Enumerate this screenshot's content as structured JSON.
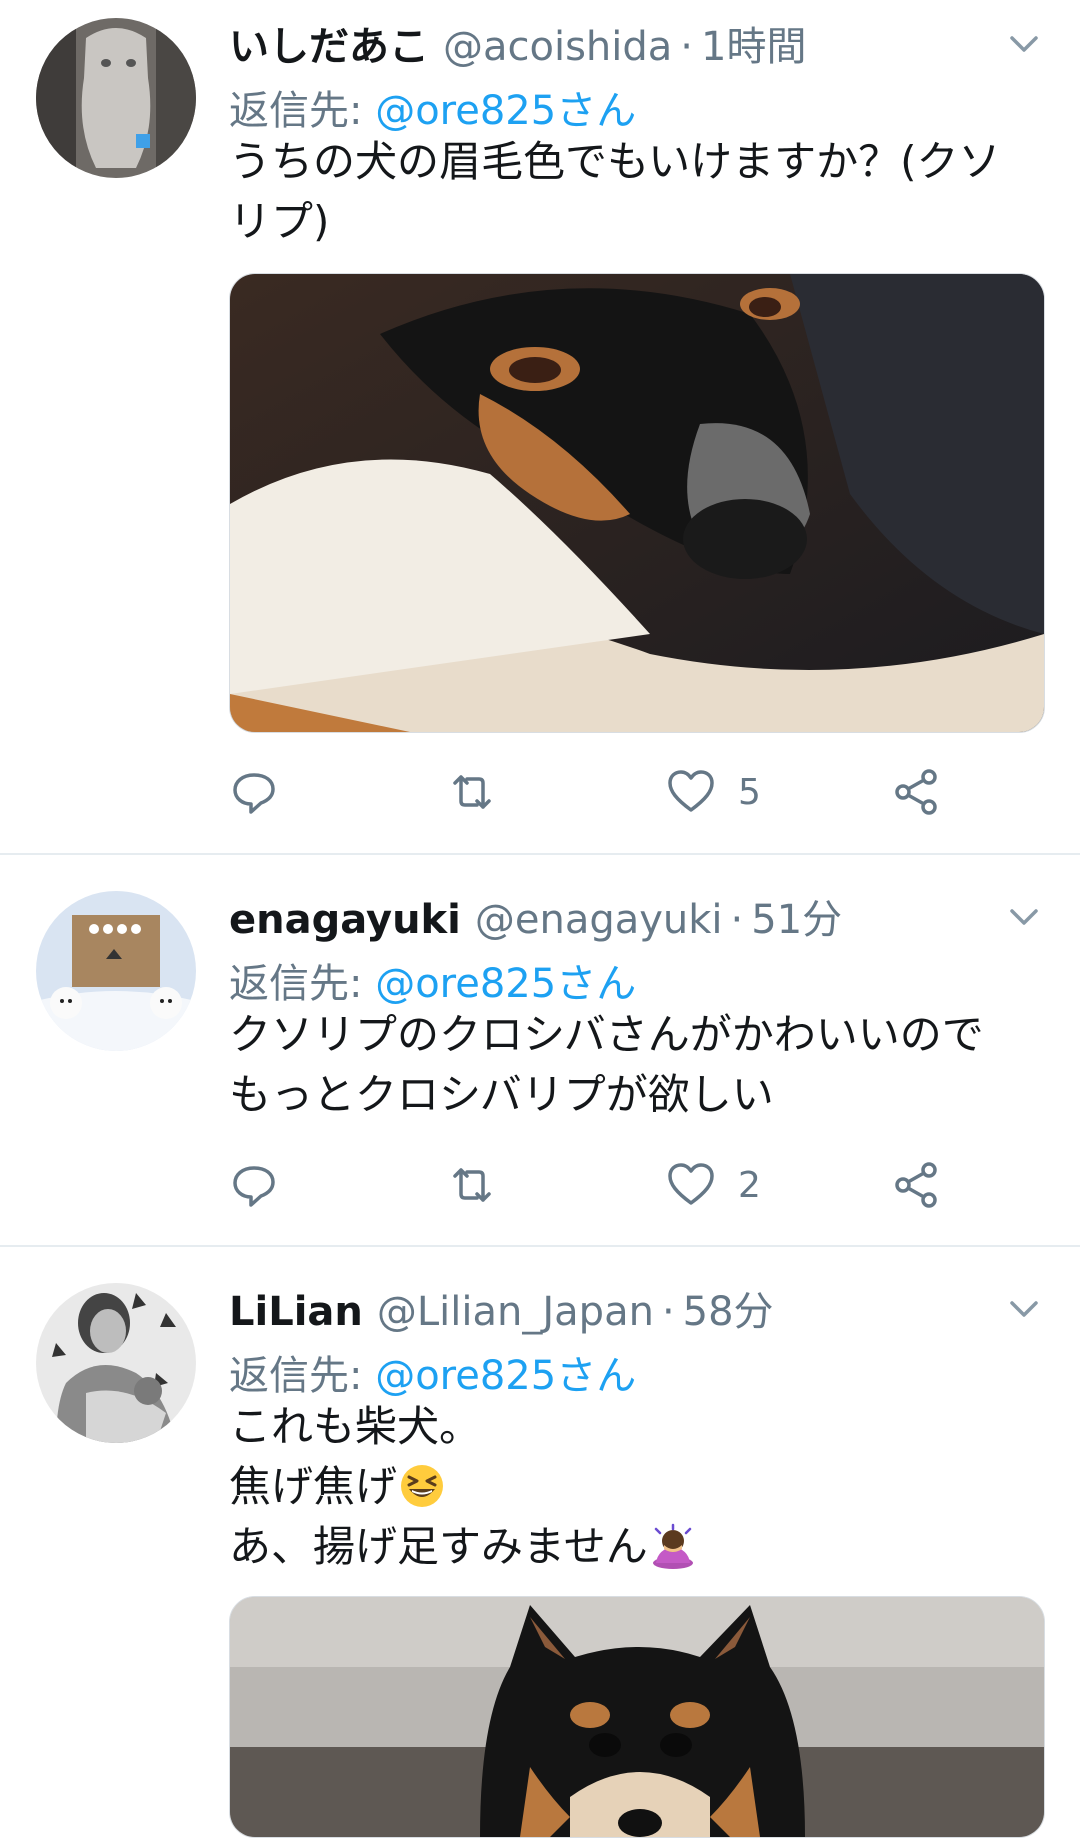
{
  "tweets": [
    {
      "name": "いしだあこ",
      "handle": "@acoishida",
      "separator": "·",
      "time": "1時間",
      "reply_prefix": "返信先: ",
      "reply_to": "@ore825さん",
      "lines": [
        "うちの犬の眉毛色でもいけますか？(クソ",
        "リプ)"
      ],
      "like_count": "5"
    },
    {
      "name": "enagayuki",
      "handle": "@enagayuki",
      "separator": "·",
      "time": "51分",
      "reply_prefix": "返信先: ",
      "reply_to": "@ore825さん",
      "lines": [
        "クソリプのクロシバさんがかわいいので",
        "もっとクロシバリプが欲しい"
      ],
      "like_count": "2"
    },
    {
      "name": "LiLian",
      "handle": "@Lilian_Japan",
      "separator": "·",
      "time": "58分",
      "reply_prefix": "返信先: ",
      "reply_to": "@ore825さん",
      "lines": [
        "これも柴犬。",
        "焦げ焦げ",
        "あ、揚げ足すみません"
      ]
    }
  ],
  "icons": {
    "reply": "reply-icon",
    "retweet": "retweet-icon",
    "like": "heart-icon",
    "share": "share-icon",
    "more": "chevron-down-icon",
    "emoji_laugh": "grinning-squinting-face-emoji",
    "emoji_bow": "person-bowing-emoji"
  },
  "colors": {
    "text": "#14171a",
    "secondary": "#657786",
    "link": "#1da1f2",
    "divider": "#e6ecf0"
  }
}
